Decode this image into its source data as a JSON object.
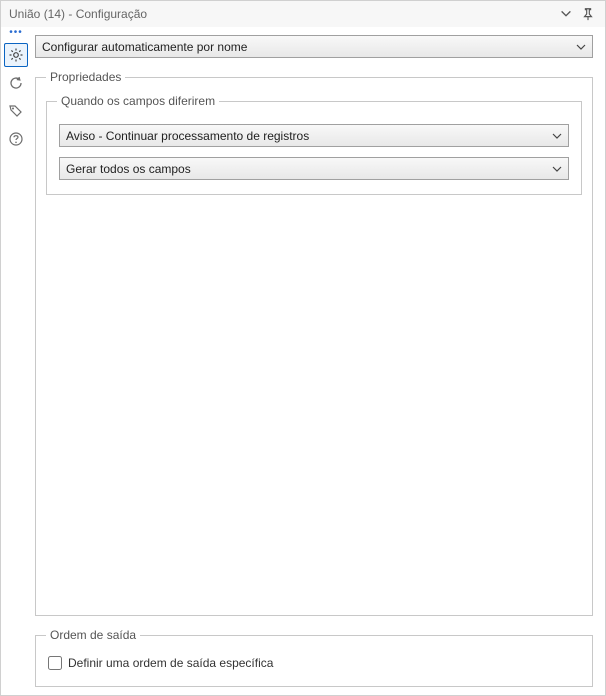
{
  "titlebar": {
    "title": "União (14) - Configuração"
  },
  "sidebar": {
    "gear_tooltip": "Configuração",
    "refresh_tooltip": "Atualizar",
    "tag_tooltip": "Anotações",
    "help_tooltip": "Ajuda"
  },
  "main": {
    "mode_select": {
      "selected": "Configurar automaticamente por nome"
    },
    "properties_group": {
      "legend": "Propriedades",
      "when_fields_differ": {
        "legend": "Quando os campos diferirem",
        "action_select": {
          "selected": "Aviso - Continuar processamento de registros"
        },
        "output_select": {
          "selected": "Gerar todos os campos"
        }
      }
    },
    "output_order_group": {
      "legend": "Ordem de saída",
      "specific_order_checkbox": {
        "label": "Definir uma ordem de saída específica",
        "checked": false
      }
    }
  }
}
